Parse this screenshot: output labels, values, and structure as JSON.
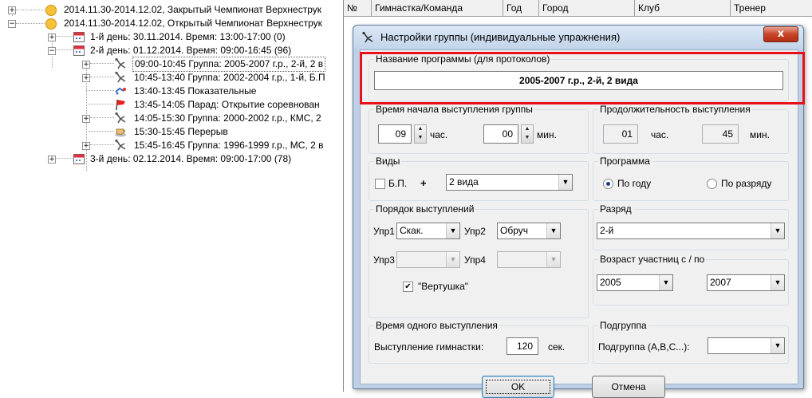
{
  "tree": {
    "items": [
      {
        "expander": "+",
        "icon": "ball-icon",
        "label": "2014.11.30-2014.12.02, Закрытый Чемпионат Верхнеструк"
      },
      {
        "expander": "−",
        "icon": "ball-icon",
        "label": "2014.11.30-2014.12.02, Открытый Чемпионат Верхнеструк"
      },
      {
        "expander": "+",
        "icon": "calendar-icon",
        "label": "1-й день: 30.11.2014. Время: 13:00-17:00 (0)"
      },
      {
        "expander": "−",
        "icon": "calendar-icon",
        "label": "2-й день: 01.12.2014. Время: 09:00-16:45 (96)"
      },
      {
        "expander": "+",
        "icon": "gymnast-icon",
        "label": "09:00-10:45 Группа: 2005-2007 г.р., 2-й, 2 в"
      },
      {
        "expander": "+",
        "icon": "gymnast-icon",
        "label": "10:45-13:40 Группа: 2002-2004 г.р., 1-й, Б.П"
      },
      {
        "expander": "",
        "icon": "show-icon",
        "label": "13:40-13:45 Показательные"
      },
      {
        "expander": "",
        "icon": "flag-icon",
        "label": "13:45-14:05 Парад: Открытие соревнован"
      },
      {
        "expander": "+",
        "icon": "gymnast-icon",
        "label": "14:05-15:30 Группа: 2000-2002 г.р., КМС, 2"
      },
      {
        "expander": "",
        "icon": "cup-icon",
        "label": "15:30-15:45 Перерыв"
      },
      {
        "expander": "+",
        "icon": "gymnast-icon",
        "label": "15:45-16:45 Группа: 1996-1999 г.р., МС, 2 в"
      },
      {
        "expander": "+",
        "icon": "calendar-icon",
        "label": "3-й день: 02.12.2014. Время: 09:00-17:00 (78)"
      }
    ]
  },
  "grid": {
    "columns": [
      "№",
      "Гимнастка/Команда",
      "Год",
      "Город",
      "Клуб",
      "Тренер"
    ]
  },
  "dialog": {
    "title": "Настройки группы (индивидуальные упражнения)",
    "close_label": "x",
    "program_name": {
      "legend": "Название программы (для протоколов)",
      "value": "2005-2007 г.р., 2-й, 2 вида"
    },
    "start_time": {
      "legend": "Время начала выступления группы",
      "hours": "09",
      "hours_unit": "час.",
      "minutes": "00",
      "minutes_unit": "мин."
    },
    "duration": {
      "legend": "Продолжительность выступления",
      "hours": "01",
      "hours_unit": "час.",
      "minutes": "45",
      "minutes_unit": "мин."
    },
    "kinds": {
      "legend": "Виды",
      "bp_label": "Б.П.",
      "bp_checked": false,
      "plus": "+",
      "selected": "2 вида"
    },
    "program": {
      "legend": "Программа",
      "by_year": "По году",
      "by_rank": "По разряду",
      "selected": "by_year"
    },
    "order": {
      "legend": "Порядок выступлений",
      "upr1_label": "Упр1",
      "upr1_value": "Скак.",
      "upr2_label": "Упр2",
      "upr2_value": "Обруч",
      "upr3_label": "Упр3",
      "upr3_value": "",
      "upr4_label": "Упр4",
      "upr4_value": "",
      "vertushka_label": "\"Вертушка\"",
      "vertushka_checked": true
    },
    "rank": {
      "legend": "Разряд",
      "value": "2-й"
    },
    "age": {
      "legend": "Возраст участниц с / по",
      "from": "2005",
      "to": "2007"
    },
    "perf_time": {
      "legend": "Время одного выступления",
      "label": "Выступление гимнастки:",
      "value": "120",
      "unit": "сек."
    },
    "subgroup": {
      "legend": "Подгруппа",
      "label": "Подгруппа (A,B,C...):",
      "value": ""
    },
    "ok_label": "OK",
    "cancel_label": "Отмена"
  },
  "colors": {
    "highlight": "#e8101a",
    "dialog_frame": "#bfd0e6"
  }
}
